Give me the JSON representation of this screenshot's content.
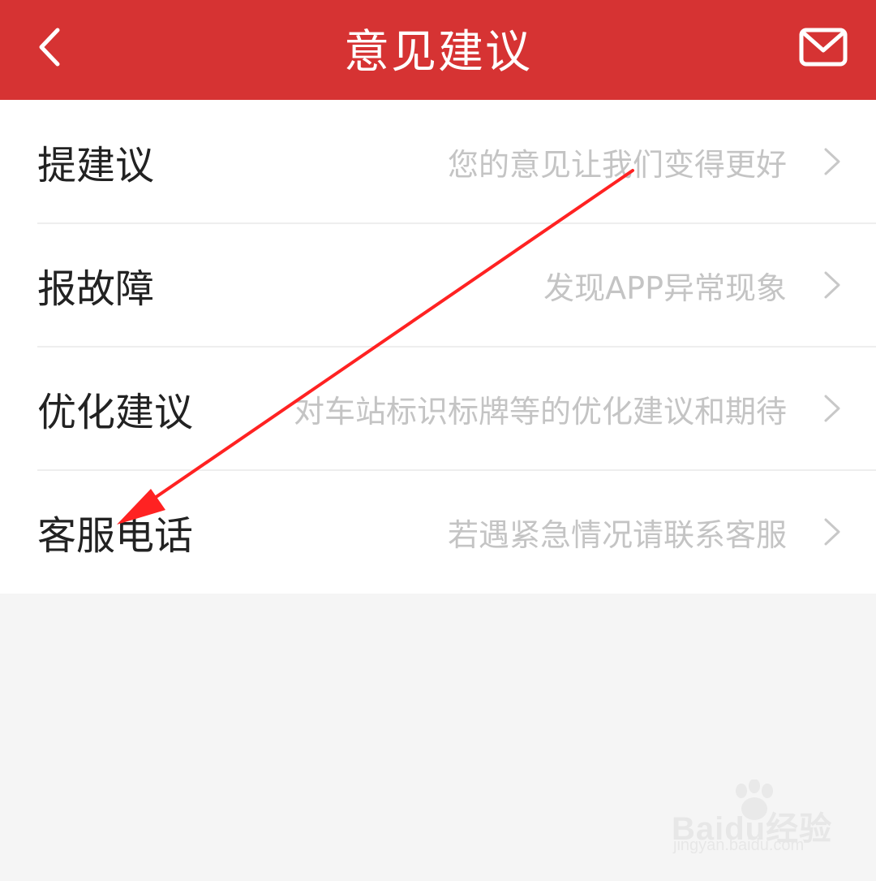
{
  "header": {
    "title": "意见建议",
    "back_icon": "chevron-left-icon",
    "mail_icon": "mail-icon",
    "background_color": "#d63333"
  },
  "rows": [
    {
      "label": "提建议",
      "description": "您的意见让我们变得更好"
    },
    {
      "label": "报故障",
      "description": "发现APP异常现象"
    },
    {
      "label": "优化建议",
      "description": "对车站标识标牌等的优化建议和期待"
    },
    {
      "label": "客服电话",
      "description": "若遇紧急情况请联系客服"
    }
  ],
  "annotation": {
    "type": "red-arrow",
    "color": "#ff2222"
  },
  "watermark": {
    "logo_text": "Baidu经验",
    "url": "jingyan.baidu.com"
  }
}
